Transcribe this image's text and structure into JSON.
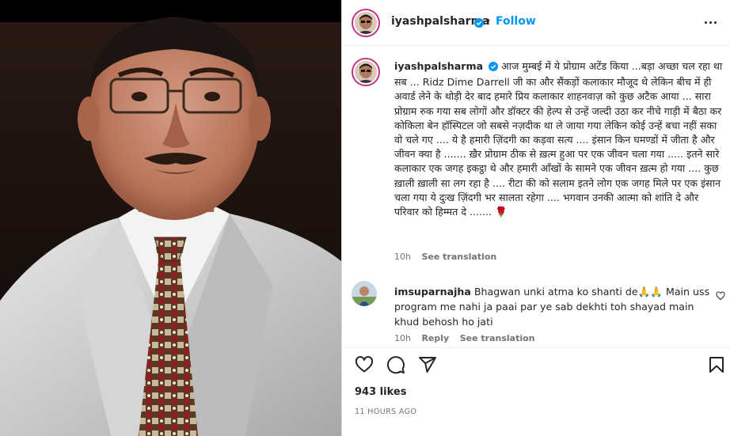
{
  "post": {
    "username": "iyashpalsharma",
    "separator": "•",
    "follow_label": "Follow",
    "caption_text": "आज मुम्बई में ये प्रोग्राम अटेंड किया ...बड़ा अच्छा चल रहा था सब ... Ridz Dime Darrell जी का और सैंकड़ों कलाकार मौजूद थे लेकिन बीच में ही अवार्ड लेने के थोड़ी देर बाद हमारे प्रिय कलाकार शाहनवाज़ को कुछ अटैक आया ... सारा प्रोग्राम रुक गया सब लोगों और डॉक्टर की हेल्प से उन्हें जल्दी उठा कर नीचे गाड़ी में बैठा कर कोकिला बेन हॉस्पिटल जो सबसे नज़दीक था ले जाया गया लेकिन कोई उन्हें बचा नहीं सका वो चले गए .... ये है हमारी ज़िंदगी का कड़वा सत्य .... इंसान किन घमण्डों में जीता है और जीवन क्या है ....... ख़ैर प्रोग्राम ठीक से ख़त्म हुआ पर एक जीवन चला गया ..... इतने सारे कलाकार एक जगह इकट्ठा थे और हमारी आँखों के सामने एक जीवन ख़त्म हो गया .... कुछ ख़ाली ख़ाली सा लग रहा है .... रीटा की को सलाम इतने लोग एक जगह मिले पर एक इंसान चला गया ये दुःख ज़िंदगी भर सालता रहेगा .... भगवान उनकी आत्मा को शांति दे और परिवार को हिम्मत दे ....... 🌹",
    "caption_time": "10h",
    "see_translation": "See translation"
  },
  "comment": {
    "username": "imsuparnajha",
    "text": "Bhagwan unki atma ko shanti de🙏🙏 Main uss program me nahi ja paai par ye sab dekhti toh shayad main khud behosh ho jati",
    "time": "10h",
    "reply": "Reply",
    "see_translation": "See translation"
  },
  "footer": {
    "likes": "943 likes",
    "time_ago": "11 HOURS AGO"
  },
  "icons": [
    "heart-icon",
    "comment-icon",
    "share-icon",
    "bookmark-icon",
    "verified-badge-icon",
    "more-options-icon"
  ],
  "colors": {
    "accent": "#0095f6",
    "verified": "#0095f6",
    "text": "#262626",
    "muted": "#737373"
  }
}
